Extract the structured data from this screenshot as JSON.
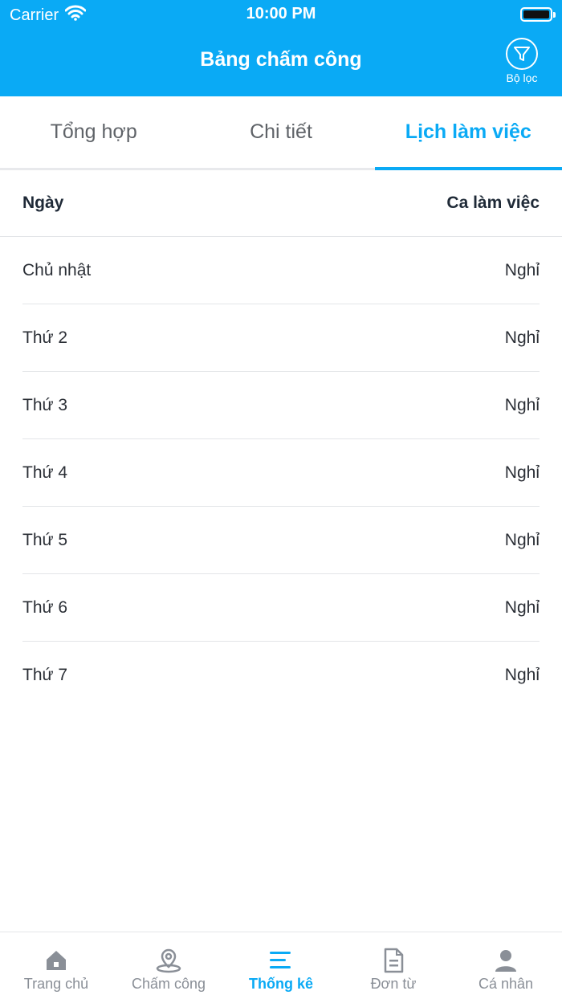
{
  "status_bar": {
    "carrier": "Carrier",
    "time": "10:00 PM"
  },
  "header": {
    "title": "Bảng chấm công",
    "filter_label": "Bộ lọc"
  },
  "tabs": [
    {
      "label": "Tổng hợp",
      "active": false
    },
    {
      "label": "Chi tiết",
      "active": false
    },
    {
      "label": "Lịch làm việc",
      "active": true
    }
  ],
  "table": {
    "col_day": "Ngày",
    "col_shift": "Ca làm việc",
    "rows": [
      {
        "day": "Chủ nhật",
        "shift": "Nghỉ"
      },
      {
        "day": "Thứ 2",
        "shift": "Nghỉ"
      },
      {
        "day": "Thứ 3",
        "shift": "Nghỉ"
      },
      {
        "day": "Thứ 4",
        "shift": "Nghỉ"
      },
      {
        "day": "Thứ 5",
        "shift": "Nghỉ"
      },
      {
        "day": "Thứ 6",
        "shift": "Nghỉ"
      },
      {
        "day": "Thứ 7",
        "shift": "Nghỉ"
      }
    ]
  },
  "tabbar": [
    {
      "label": "Trang chủ",
      "icon": "home-icon",
      "active": false
    },
    {
      "label": "Chấm công",
      "icon": "location-pin-icon",
      "active": false
    },
    {
      "label": "Thống kê",
      "icon": "list-lines-icon",
      "active": true
    },
    {
      "label": "Đơn từ",
      "icon": "document-icon",
      "active": false
    },
    {
      "label": "Cá nhân",
      "icon": "user-icon",
      "active": false
    }
  ],
  "colors": {
    "accent": "#0aaaf5",
    "inactive": "#8a8f97",
    "text": "#1f2a37"
  }
}
